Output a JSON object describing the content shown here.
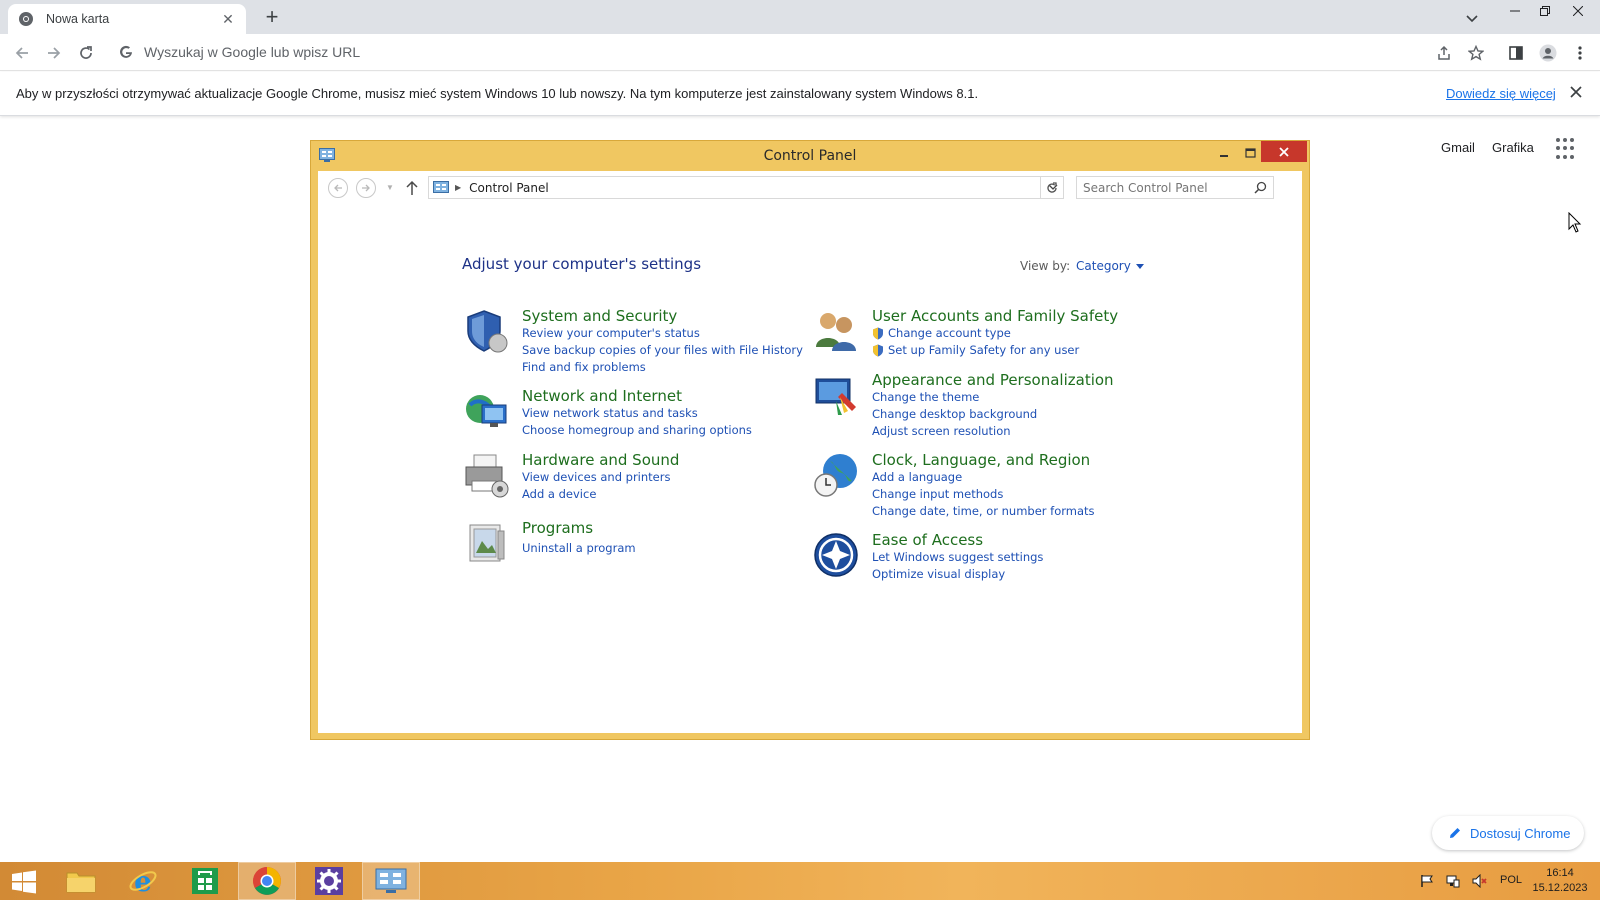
{
  "browser": {
    "tab": {
      "title": "Nowa karta"
    },
    "omnibox": {
      "placeholder": "Wyszukaj w Google lub wpisz URL"
    },
    "infobar": {
      "message": "Aby w przyszłości otrzymywać aktualizacje Google Chrome, musisz mieć system Windows 10 lub nowszy. Na tym komputerze jest zainstalowany system Windows 8.1.",
      "link": "Dowiedz się więcej"
    }
  },
  "ntp": {
    "gmail": "Gmail",
    "images": "Grafika",
    "customize": "Dostosuj Chrome"
  },
  "control_panel": {
    "title": "Control Panel",
    "address": "Control Panel",
    "search_placeholder": "Search Control Panel",
    "heading": "Adjust your computer's settings",
    "view_by_label": "View by:",
    "view_by_value": "Category",
    "categories": [
      {
        "title": "System and Security",
        "links": [
          "Review your computer's status",
          "Save backup copies of your files with File History",
          "Find and fix problems"
        ]
      },
      {
        "title": "Network and Internet",
        "links": [
          "View network status and tasks",
          "Choose homegroup and sharing options"
        ]
      },
      {
        "title": "Hardware and Sound",
        "links": [
          "View devices and printers",
          "Add a device"
        ]
      },
      {
        "title": "Programs",
        "links": [
          "Uninstall a program"
        ]
      },
      {
        "title": "User Accounts and Family Safety",
        "links": [
          "Change account type",
          "Set up Family Safety for any user"
        ]
      },
      {
        "title": "Appearance and Personalization",
        "links": [
          "Change the theme",
          "Change desktop background",
          "Adjust screen resolution"
        ]
      },
      {
        "title": "Clock, Language, and Region",
        "links": [
          "Add a language",
          "Change input methods",
          "Change date, time, or number formats"
        ]
      },
      {
        "title": "Ease of Access",
        "links": [
          "Let Windows suggest settings",
          "Optimize visual display"
        ]
      }
    ]
  },
  "taskbar": {
    "language": "POL",
    "time": "16:14",
    "date": "15.12.2023"
  },
  "colors": {
    "window_frame": "#f0c761",
    "close_button": "#c7372b",
    "category_title": "#1e6e1e",
    "link": "#1e50b4",
    "chrome_link": "#1a73e8"
  }
}
